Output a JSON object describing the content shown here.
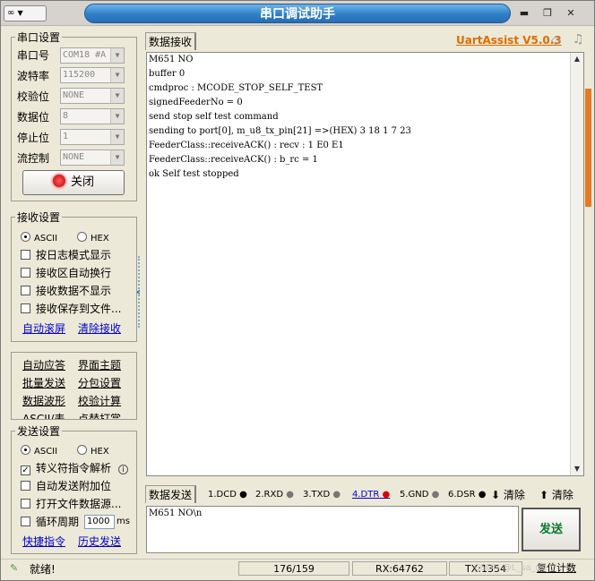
{
  "app": {
    "title": "串口调试助手",
    "brand": "UartAssist V5.0.3",
    "brand_color": "#e06c00"
  },
  "window": {
    "menu_icon": "∞",
    "menu_arrow": "▼",
    "min": "▬",
    "restore": "❐",
    "close": "✕"
  },
  "serial": {
    "group": "串口设置",
    "port_label": "串口号",
    "port_value": "COM18 #A",
    "baud_label": "波特率",
    "baud_value": "115200",
    "parity_label": "校验位",
    "parity_value": "NONE",
    "databits_label": "数据位",
    "databits_value": "8",
    "stop_label": "停止位",
    "stop_value": "1",
    "flow_label": "流控制",
    "flow_value": "NONE",
    "close_button": "关闭"
  },
  "recv": {
    "group": "接收设置",
    "ascii": "ASCII",
    "hex": "HEX",
    "opt1": "按日志模式显示",
    "opt2": "接收区自动换行",
    "opt3": "接收数据不显示",
    "opt4": "接收保存到文件...",
    "autoscroll": "自动滚屏",
    "clear": "清除接收"
  },
  "tools": {
    "l1": "自动应答",
    "r1": "界面主题",
    "l2": "批量发送",
    "r2": "分包设置",
    "l3": "数据波形",
    "r3": "校验计算",
    "l4": "ASCII/表",
    "r4": "点替打赏"
  },
  "send": {
    "group": "发送设置",
    "ascii": "ASCII",
    "hex": "HEX",
    "opt1": "转义符指令解析",
    "opt2": "自动发送附加位",
    "opt3": "打开文件数据源...",
    "opt4": "循环周期",
    "period": "1000",
    "unit": "ms",
    "shortcut": "快捷指令",
    "history": "历史发送"
  },
  "rxpanel": {
    "tab": "数据接收",
    "lines": [
      "M651 NO",
      "buffer 0",
      "cmdproc : MCODE_STOP_SELF_TEST",
      "signedFeederNo = 0",
      "send stop self test command",
      "sending to port[0], m_u8_tx_pin[21] =>(HEX) 3 18 1 7 23",
      "FeederClass::receiveACK() : recv : 1 E0 E1",
      "FeederClass::receiveACK() : b_rc = 1",
      "ok Self test stopped"
    ]
  },
  "txpanel": {
    "tab": "数据发送",
    "dcd": "1.DCD",
    "rxd": "2.RXD",
    "txd": "3.TXD",
    "dtr": "4.DTR",
    "gnd": "5.GND",
    "dsr": "6.DSR",
    "clear1": "清除",
    "clear2": "清除",
    "text": "M651 NO\\n",
    "send_button": "发送"
  },
  "status": {
    "ready": "就绪!",
    "count": "176/159",
    "rx": "RX:64762",
    "tx": "TX:1354",
    "reset": "复位计数",
    "watermark": "CSDN @L_sa_ds"
  }
}
